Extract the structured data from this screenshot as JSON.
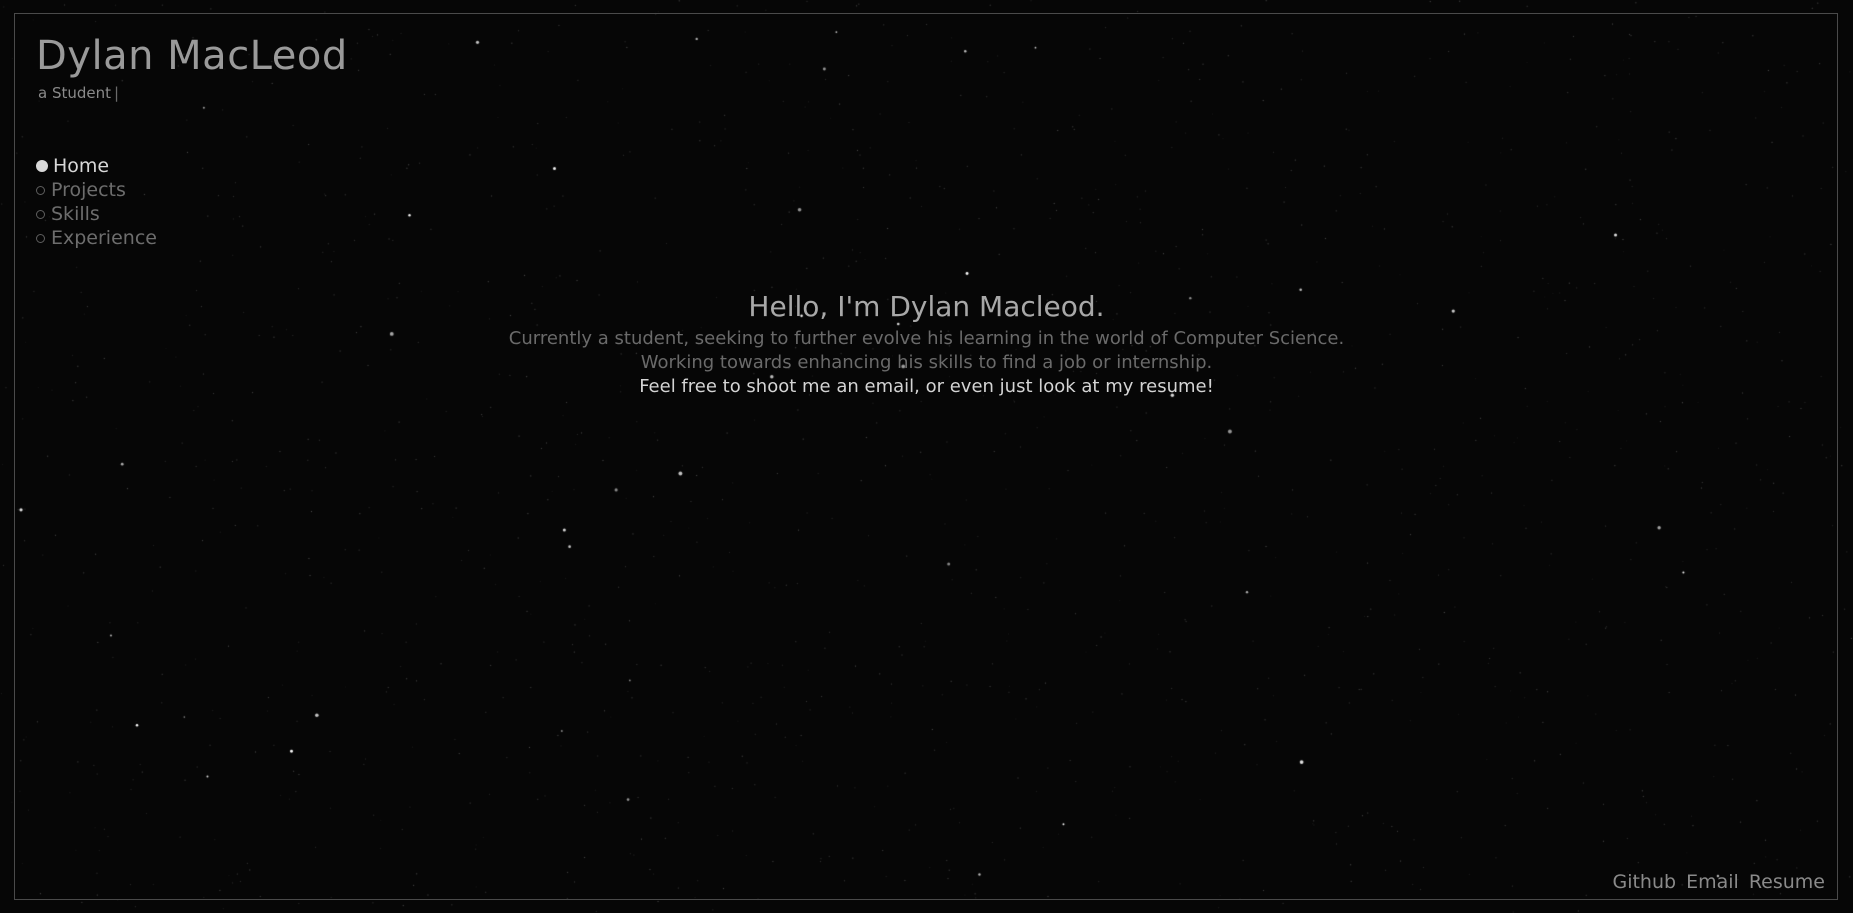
{
  "header": {
    "title": "Dylan MacLeod",
    "tagline": "a Student",
    "cursor": "|"
  },
  "nav": {
    "items": [
      {
        "label": "Home",
        "active": true
      },
      {
        "label": "Projects",
        "active": false
      },
      {
        "label": "Skills",
        "active": false
      },
      {
        "label": "Experience",
        "active": false
      }
    ]
  },
  "hero": {
    "heading": "Hello, I'm Dylan Macleod.",
    "line1": "Currently a student, seeking to further evolve his learning in the world of Computer Science.",
    "line2": "Working towards enhancing his skills to find a job or internship.",
    "line3": "Feel free to shoot me an email, or even just look at my resume!"
  },
  "footer": {
    "github": "Github",
    "email": "Email",
    "resume": "Resume"
  },
  "colors": {
    "background": "#060606",
    "frame": "#4a4a4a",
    "active_text": "#d8d8d8",
    "muted_text": "#6d6d6d"
  }
}
